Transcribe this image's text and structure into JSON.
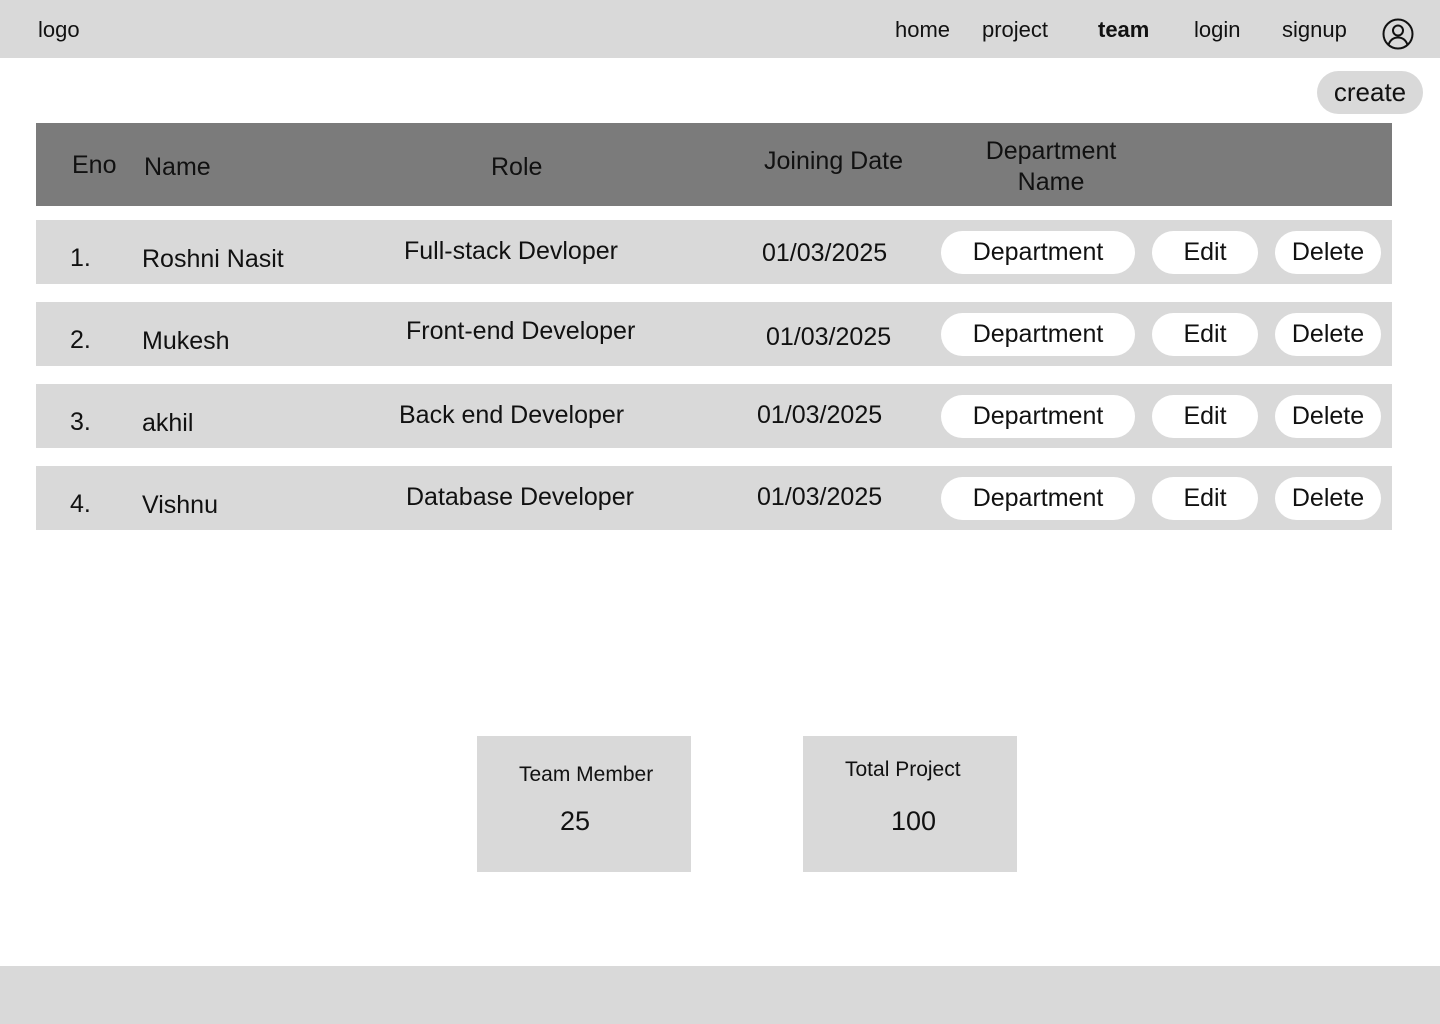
{
  "header": {
    "logo": "logo",
    "nav": [
      "home",
      "project",
      "team",
      "login",
      "signup"
    ],
    "active_nav": "team"
  },
  "actions": {
    "create_label": "create"
  },
  "table": {
    "columns": [
      "Eno",
      "Name",
      "Role",
      "Joining Date",
      "Department\nName"
    ],
    "rows": [
      {
        "eno": "1.",
        "name": "Roshni Nasit",
        "role": "Full-stack Devloper",
        "date": "01/03/2025"
      },
      {
        "eno": "2.",
        "name": "Mukesh",
        "role": "Front-end Developer",
        "date": "01/03/2025"
      },
      {
        "eno": "3.",
        "name": "akhil",
        "role": "Back end Developer",
        "date": "01/03/2025"
      },
      {
        "eno": "4.",
        "name": "Vishnu",
        "role": "Database Developer",
        "date": "01/03/2025"
      }
    ],
    "row_buttons": {
      "department": "Department",
      "edit": "Edit",
      "delete": "Delete"
    }
  },
  "stats": {
    "team_member": {
      "label": "Team Member",
      "value": "25"
    },
    "total_project": {
      "label": "Total Project",
      "value": "100"
    }
  },
  "colors": {
    "bar": "#d9d9d9",
    "table_header": "#7b7b7b",
    "row": "#d9d9d9",
    "pill": "#ffffff"
  },
  "icons": {
    "profile": "user-circle-icon"
  }
}
